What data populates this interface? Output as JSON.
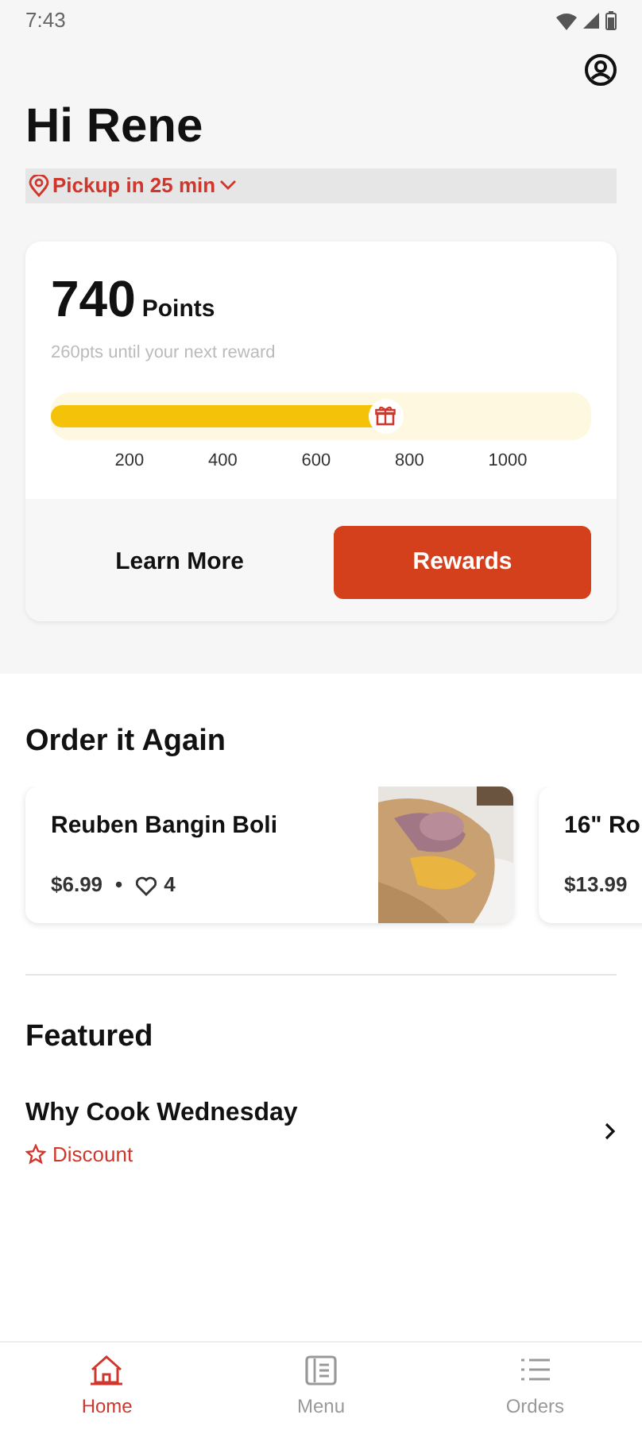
{
  "status_bar": {
    "time": "7:43"
  },
  "greeting": "Hi Rene",
  "pickup": {
    "label": "Pickup in 25 min"
  },
  "rewards": {
    "points": "740",
    "points_label": "Points",
    "subtitle": "260pts until your next reward",
    "level": 0.62,
    "ticks": [
      "200",
      "400",
      "600",
      "800",
      "1000"
    ],
    "buttons": [
      {
        "label": "Learn More",
        "kind": "link"
      },
      {
        "label": "Rewards",
        "kind": "primary"
      }
    ]
  },
  "order_again": {
    "title": "Order it Again",
    "items": [
      {
        "name": "Reuben Bangin Boli",
        "price": "$6.99",
        "separator": "•",
        "likes": "4",
        "kind": "picture"
      },
      {
        "name": "16\" Ro",
        "price": "$13.99"
      }
    ]
  },
  "featured": {
    "title": "Featured",
    "items": [
      {
        "title": "Why Cook Wednesday",
        "tag": "Discount"
      }
    ]
  },
  "bottom_nav": [
    {
      "label": "Home",
      "kind": "home",
      "selected": true
    },
    {
      "label": "Menu",
      "kind": "menu",
      "selected": false
    },
    {
      "label": "Orders",
      "kind": "orders",
      "selected": false
    }
  ]
}
